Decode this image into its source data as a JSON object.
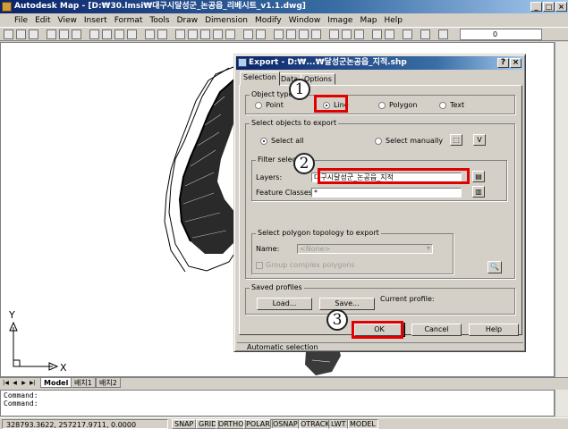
{
  "app": {
    "title": "Autodesk Map - [D:₩30.lmsi₩대구시달성군_논공읍_리베시트_v1.1.dwg]",
    "menu": [
      "File",
      "Edit",
      "View",
      "Insert",
      "Format",
      "Tools",
      "Draw",
      "Dimension",
      "Modify",
      "Window",
      "Image",
      "Map",
      "Help"
    ],
    "layer_value": "0"
  },
  "layout_tabs": [
    "Model",
    "배치1",
    "배치2"
  ],
  "command_lines": [
    "Command:",
    "Command:"
  ],
  "ucs": {
    "y_label": "Y",
    "x_label": "X"
  },
  "status": {
    "coords": "328793.3622, 257217.9711, 0.0000",
    "buttons": [
      "SNAP",
      "GRID",
      "ORTHO",
      "POLAR",
      "OSNAP",
      "OTRACK",
      "LWT",
      "MODEL"
    ]
  },
  "dialog": {
    "title": "Export - D:₩...₩달성군논공읍_지적.shp",
    "tabs": [
      "Selection",
      "Data",
      "Options"
    ],
    "object_type": {
      "label": "Object type",
      "options": [
        "Point",
        "Line",
        "Polygon",
        "Text"
      ],
      "selected": "Line"
    },
    "select_objects": {
      "label": "Select objects to export",
      "select_all": "Select all",
      "select_manually": "Select manually"
    },
    "filter": {
      "label": "Filter selection",
      "layers_label": "Layers:",
      "layers_value": "대구시달성군_논공읍_지적",
      "feature_label": "Feature Classes:",
      "feature_value": "*"
    },
    "topology": {
      "label": "Select polygon topology to export",
      "name_label": "Name:",
      "name_value": "<None>",
      "group_label": "Group complex polygons"
    },
    "profiles": {
      "label": "Saved profiles",
      "load": "Load...",
      "save": "Save...",
      "current": "Current profile:"
    },
    "buttons": {
      "ok": "OK",
      "cancel": "Cancel",
      "help": "Help"
    },
    "status_text": "Automatic selection"
  },
  "callouts": [
    "1",
    "2",
    "3"
  ],
  "colors": {
    "annotation": "#e00000",
    "title_bar": "#0a246a"
  }
}
